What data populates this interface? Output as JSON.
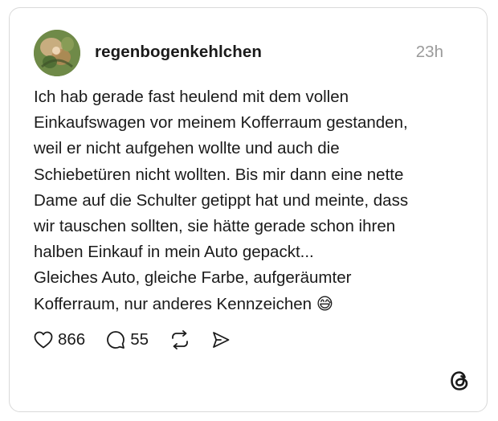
{
  "post": {
    "username": "regenbogenkehlchen",
    "timestamp": "23h",
    "text": "Ich hab gerade fast heulend mit dem vollen\nEinkaufswagen vor meinem Kofferraum gestanden,\nweil er nicht aufgehen wollte und auch die\nSchiebetüren nicht wollten. Bis mir dann eine nette\nDame auf die Schulter getippt hat und meinte, dass\nwir tauschen sollten, sie hätte gerade schon ihren\nhalben Einkauf in mein Auto gepackt...\nGleiches Auto, gleiche Farbe, aufgeräumter\nKofferraum, nur anderes Kennzeichen 😅"
  },
  "actions": {
    "likes": "866",
    "replies": "55",
    "icons": [
      "heart-icon",
      "comment-icon",
      "repost-icon",
      "share-icon"
    ]
  },
  "branding": {
    "logo": "threads-logo-icon"
  },
  "colors": {
    "text": "#1a1a1a",
    "muted": "#9a9a9a",
    "border": "#d9d9d9"
  }
}
